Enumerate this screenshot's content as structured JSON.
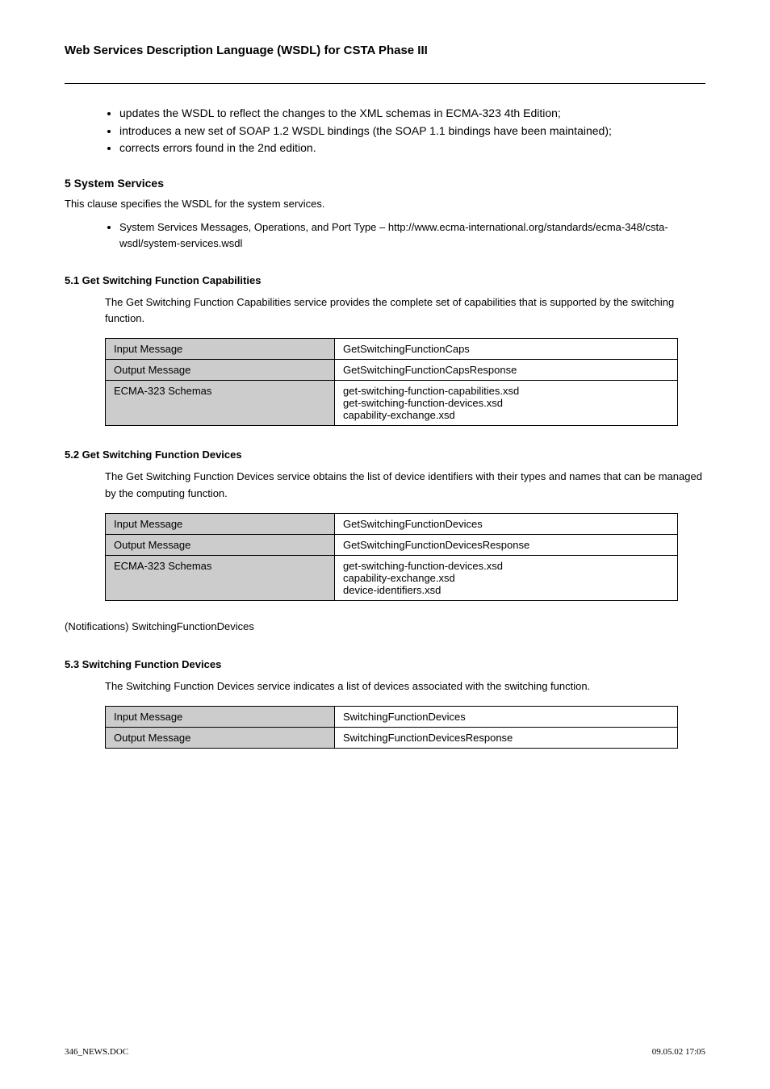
{
  "header_title": "Web Services Description Language (WSDL) for CSTA Phase III",
  "intro_bullets": [
    "updates the WSDL to reflect the changes to the XML schemas in ECMA-323 4th Edition;",
    "introduces a new set of SOAP 1.2 WSDL bindings (the SOAP 1.1 bindings have been maintained);",
    "corrects errors found in the 2nd edition."
  ],
  "sec5_title": "5 System Services",
  "sec5_body": "This clause specifies the WSDL for the system services.",
  "sys_bullet": "System Services Messages, Operations, and Port Type – http://www.ecma-international.org/standards/ecma-348/csta-wsdl/system-services.wsdl",
  "sec51": {
    "title": "5.1 Get Switching Function Capabilities",
    "desc": "The Get Switching Function Capabilities service provides the complete set of capabilities that is supported by the switching function.",
    "rows": [
      [
        "Input Message",
        "GetSwitchingFunctionCaps"
      ],
      [
        "Output Message",
        "GetSwitchingFunctionCapsResponse"
      ],
      [
        "ECMA-323 Schemas",
        "get-switching-function-capabilities.xsd\nget-switching-function-devices.xsd\ncapability-exchange.xsd"
      ]
    ]
  },
  "sec52": {
    "title": "5.2 Get Switching Function Devices",
    "desc": "The Get Switching Function Devices service obtains the list of device identifiers with their types and names that can be managed by the computing function.",
    "rows": [
      [
        "Input Message",
        "GetSwitchingFunctionDevices"
      ],
      [
        "Output Message",
        "GetSwitchingFunctionDevicesResponse"
      ],
      [
        "ECMA-323 Schemas",
        "get-switching-function-devices.xsd\ncapability-exchange.xsd\ndevice-identifiers.xsd"
      ]
    ]
  },
  "notif": "(Notifications) SwitchingFunctionDevices",
  "sec53": {
    "title": "5.3 Switching Function Devices",
    "desc": "The Switching Function Devices service indicates a list of devices associated with the switching function.",
    "rows": [
      [
        "Input Message",
        "SwitchingFunctionDevices"
      ],
      [
        "Output Message",
        "SwitchingFunctionDevicesResponse"
      ]
    ]
  },
  "footer_left": "346_NEWS.DOC",
  "footer_right": "09.05.02 17:05"
}
